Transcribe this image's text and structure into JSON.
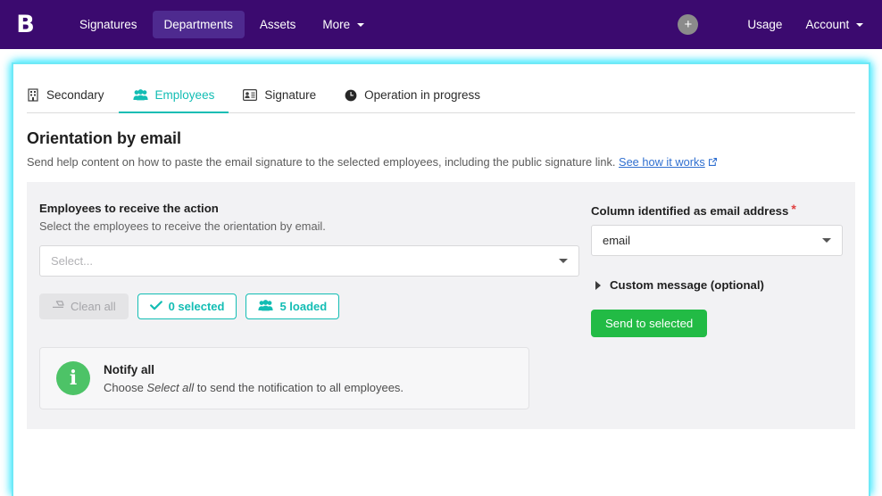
{
  "navbar": {
    "logo_letter": "B",
    "items": [
      {
        "label": "Signatures",
        "active": false
      },
      {
        "label": "Departments",
        "active": true
      },
      {
        "label": "Assets",
        "active": false
      },
      {
        "label": "More",
        "active": false,
        "caret": true
      }
    ],
    "add_button_label": "+",
    "usage_label": "Usage",
    "account_label": "Account"
  },
  "tabs": [
    {
      "label": "Secondary",
      "icon": "building-icon",
      "active": false
    },
    {
      "label": "Employees",
      "icon": "users-icon",
      "active": true
    },
    {
      "label": "Signature",
      "icon": "id-card-icon",
      "active": false
    },
    {
      "label": "Operation in progress",
      "icon": "clock-icon",
      "active": false
    }
  ],
  "header": {
    "title": "Orientation by email",
    "subtitle": "Send help content on how to paste the email signature to the selected employees, including the public signature link.",
    "link_label": "See how it works"
  },
  "left_column": {
    "label": "Employees to receive the action",
    "help": "Select the employees to receive the orientation by email.",
    "select_placeholder": "Select...",
    "select_value": "",
    "buttons": [
      {
        "label": "Clean all",
        "icon": "eraser-icon",
        "state": "disabled"
      },
      {
        "label": "0 selected",
        "icon": "check-icon",
        "state": "outline"
      },
      {
        "label": "5 loaded",
        "icon": "users-icon",
        "state": "outline"
      }
    ]
  },
  "right_column": {
    "label": "Column identified as email address",
    "required_marker": "*",
    "select_value": "email",
    "collapse_label": "Custom message (optional)",
    "send_label": "Send to selected"
  },
  "notify": {
    "title": "Notify all",
    "text_before": "Choose ",
    "text_emphasis": "Select all",
    "text_after": " to send the notification to all employees.",
    "icon": "info-icon"
  },
  "colors": {
    "navbar_purple": "#3b0a6f",
    "nav_active_purple": "#4e2a8f",
    "teal": "#13bdb4",
    "green": "#22bb45",
    "info_green": "#4dc367",
    "link_blue": "#2f6fd0",
    "required_red": "#e04141",
    "panel_gray": "#f2f2f4",
    "glow_cyan": "#6fe9f7"
  }
}
